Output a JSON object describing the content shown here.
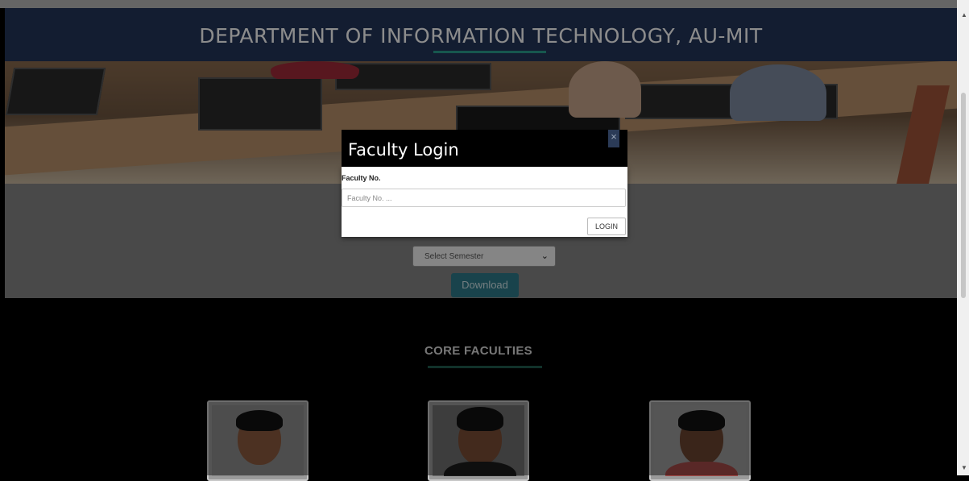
{
  "header": {
    "title": "DEPARTMENT OF INFORMATION TECHNOLOGY, AU-MIT"
  },
  "download_section": {
    "semester_select": {
      "selected": "Select Semester"
    },
    "download_button": "Download"
  },
  "faculties": {
    "title": "CORE FACULTIES",
    "photos": [
      "faculty-photo-1",
      "faculty-photo-2",
      "faculty-photo-3"
    ]
  },
  "modal": {
    "title": "Faculty Login",
    "close": "×",
    "field_label": "Faculty No.",
    "field_placeholder": "Faculty No. ...",
    "login_button": "LOGIN"
  },
  "icons": {
    "close": "close-icon",
    "chevron": "chevron-down-icon"
  },
  "colors": {
    "header_bg": "#243559",
    "accent": "#2a9e8e",
    "download_button": "#2f7a8a"
  }
}
